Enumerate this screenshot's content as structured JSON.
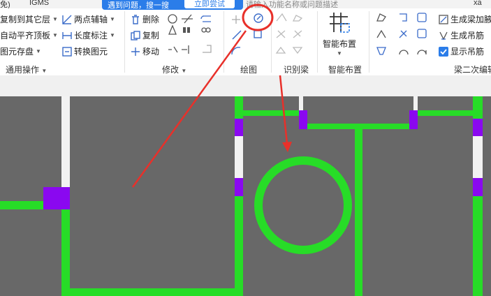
{
  "topbar": {
    "left_text": "免)",
    "app_name": "IGMS",
    "search_placeholder": "请输入功能名称或问题描述",
    "right_text": "xa"
  },
  "tooltip": {
    "text": "遇到问题，搜一搜",
    "button": "立即尝试"
  },
  "groups": {
    "general": {
      "label": "通用操作",
      "items": [
        "复制到其它层",
        "自动平齐顶板",
        "图元存盘",
        "两点辅轴",
        "长度标注",
        "转换图元"
      ]
    },
    "modify": {
      "label": "修改",
      "items": [
        "删除",
        "复制",
        "移动"
      ]
    },
    "draw": {
      "label": "绘图"
    },
    "identify": {
      "label": "识别梁"
    },
    "smart": {
      "label": "智能布置",
      "button": "智能布置"
    },
    "secondary": {
      "label": "梁二次编辑",
      "items": [
        "生成梁加腋",
        "生成吊筋",
        "显示吊筋"
      ]
    }
  },
  "colors": {
    "beam": "#27dc27",
    "column": "#8a08f0",
    "wall": "#f2f2f2",
    "canvas": "#686868",
    "annotation": "#e8302a",
    "accent": "#2b7de9"
  }
}
